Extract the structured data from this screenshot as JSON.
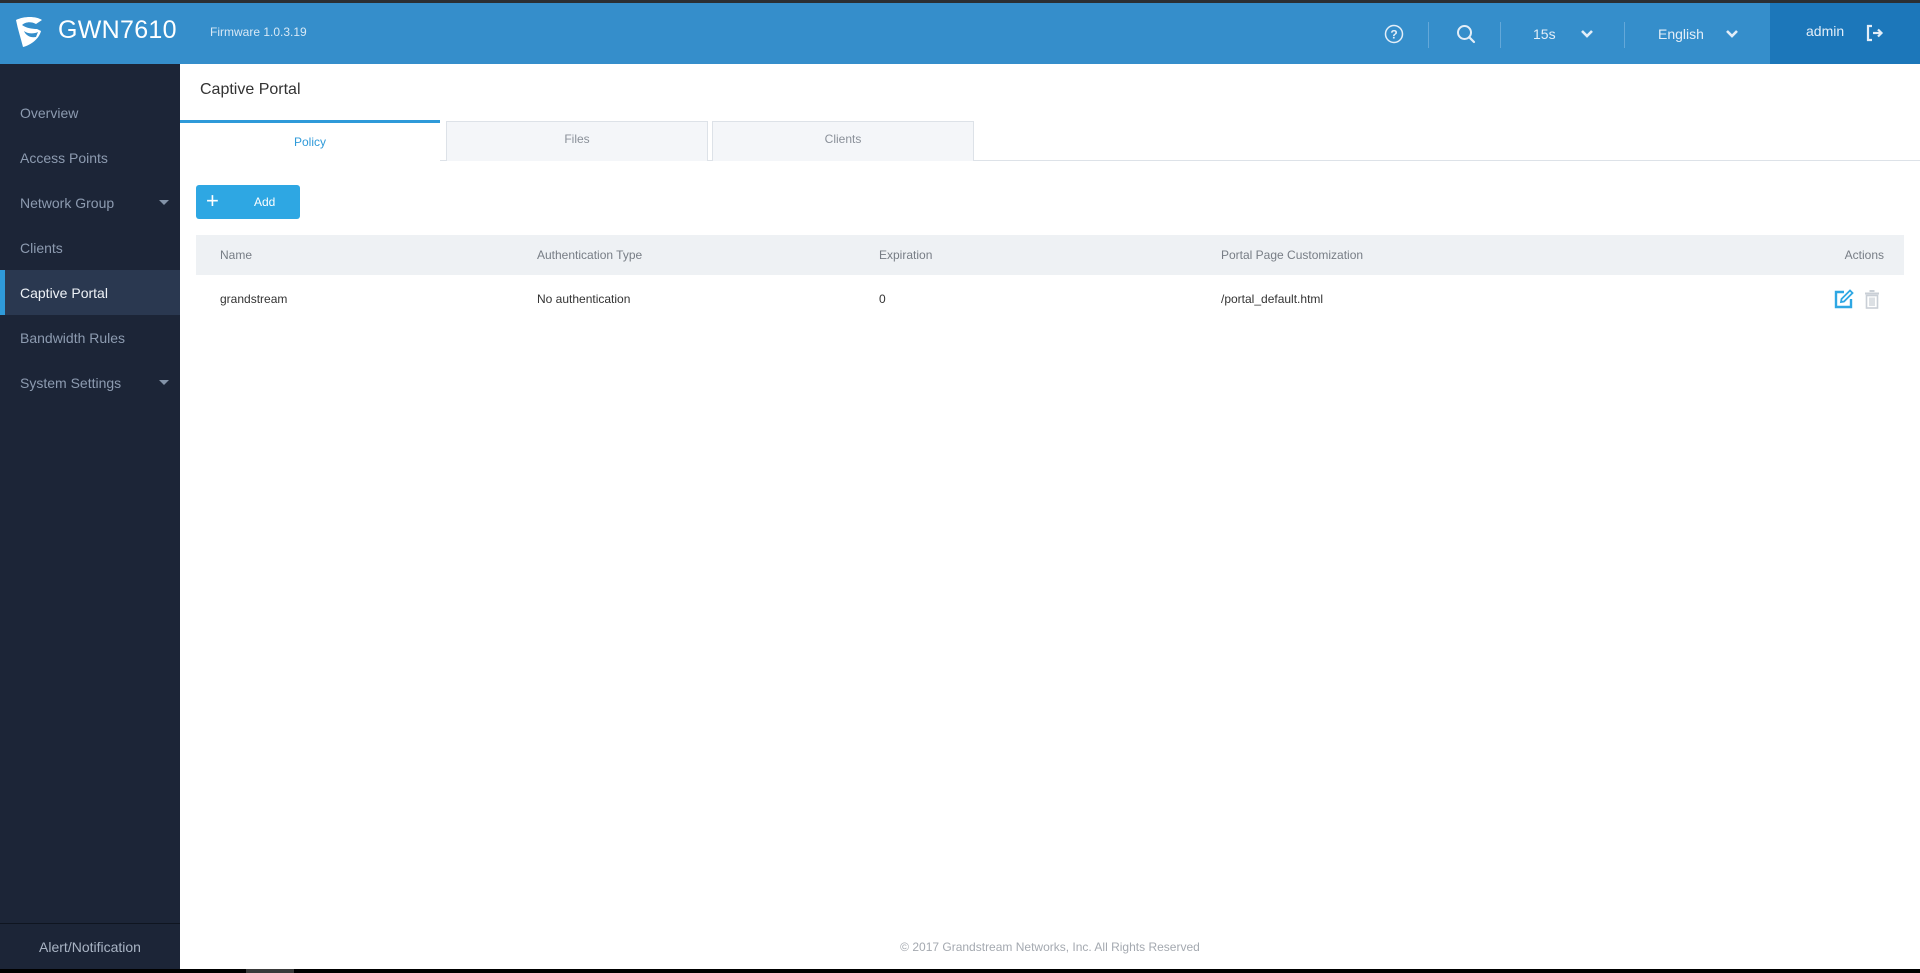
{
  "header": {
    "product": "GWN7610",
    "firmware": "Firmware 1.0.3.19",
    "refresh_interval": "15s",
    "language": "English",
    "user": "admin",
    "icons": {
      "logo": "grandstream-logo-icon",
      "help": "help-circle-icon",
      "search": "search-icon",
      "chevron": "chevron-down-icon",
      "logout": "logout-icon"
    }
  },
  "sidebar": {
    "items": [
      {
        "label": "Overview",
        "active": false,
        "expandable": false
      },
      {
        "label": "Access Points",
        "active": false,
        "expandable": false
      },
      {
        "label": "Network Group",
        "active": false,
        "expandable": true
      },
      {
        "label": "Clients",
        "active": false,
        "expandable": false
      },
      {
        "label": "Captive Portal",
        "active": true,
        "expandable": false
      },
      {
        "label": "Bandwidth Rules",
        "active": false,
        "expandable": false
      },
      {
        "label": "System Settings",
        "active": false,
        "expandable": true
      }
    ],
    "bottom": "Alert/Notification"
  },
  "main": {
    "title": "Captive Portal",
    "tabs": [
      {
        "label": "Policy",
        "active": true
      },
      {
        "label": "Files",
        "active": false
      },
      {
        "label": "Clients",
        "active": false
      }
    ],
    "add_label": "Add",
    "table": {
      "columns": [
        "Name",
        "Authentication Type",
        "Expiration",
        "Portal Page Customization",
        "Actions"
      ],
      "rows": [
        {
          "name": "grandstream",
          "auth_type": "No authentication",
          "expiration": "0",
          "portal_page": "/portal_default.html",
          "actions": [
            "edit-icon",
            "delete-icon"
          ]
        }
      ]
    },
    "footer": "© 2017 Grandstream Networks, Inc. All Rights Reserved"
  },
  "colors": {
    "header_bg": "#358ecb",
    "user_bg": "#1c77ba",
    "sidebar_bg": "#1c2537",
    "sidebar_active_bg": "#2a3850",
    "accent": "#2f9ad9",
    "add_button": "#2ea7e3"
  }
}
